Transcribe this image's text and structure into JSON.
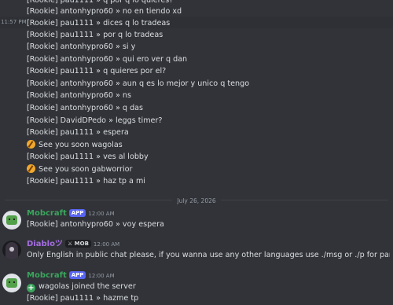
{
  "colors": {
    "background": "#313338",
    "mobcraft_name": "#3ba55d",
    "diablo_name": "#a56de2",
    "app_badge": "#5865f2"
  },
  "older_lines": [
    {
      "text": "[Rookie] pau1111 » q por q lo quieres?"
    },
    {
      "text": "[Rookie] antonhypro60 » no en tiendo xd"
    },
    {
      "text": "[Rookie] pau1111 » dices q lo tradeas",
      "timestamp": "11:57 PM"
    },
    {
      "text": "[Rookie] pau1111 » por q lo tradeas"
    },
    {
      "text": "[Rookie] antonhypro60 » si y"
    },
    {
      "text": "[Rookie] antonhypro60 » qui ero ver q dan"
    },
    {
      "text": "[Rookie] pau1111 » q quieres por el?"
    },
    {
      "text": "[Rookie] antonhypro60 » aun q es lo mejor y unico q tengo"
    },
    {
      "text": "[Rookie] antonhypro60 » ns"
    },
    {
      "text": "[Rookie] antonhypro60 » q das"
    },
    {
      "text": "[Rookie] DavidDPedo » leggs timer?"
    },
    {
      "text": "[Rookie] pau1111 » espera"
    },
    {
      "text": "See you soon wagolas",
      "emoji": "leave-icon"
    },
    {
      "text": "[Rookie] pau1111 » ves al lobby"
    },
    {
      "text": "See you soon gabworrior",
      "emoji": "leave-icon"
    },
    {
      "text": "[Rookie] pau1111 » haz tp a mi"
    }
  ],
  "date_divider": "July 26, 2026",
  "messages": [
    {
      "author": "Mobcraft",
      "badge": "APP",
      "time": "12:00 AM",
      "avatar": "mobcraft-avatar",
      "lines": [
        "[Rookie] antonhypro60 » voy espera"
      ]
    },
    {
      "author": "Diabloツ",
      "badge": "MOB",
      "time": "12:00 AM",
      "avatar": "diablo-avatar",
      "lines": [
        "Only English in public chat please, if you wanna use any other languages use ./msg or ./p for party chat."
      ]
    },
    {
      "author": "Mobcraft",
      "badge": "APP",
      "time": "12:00 AM",
      "avatar": "mobcraft-avatar",
      "lines": [
        "wagolas joined the server",
        "[Rookie] pau1111 » hazme tp"
      ]
    }
  ]
}
